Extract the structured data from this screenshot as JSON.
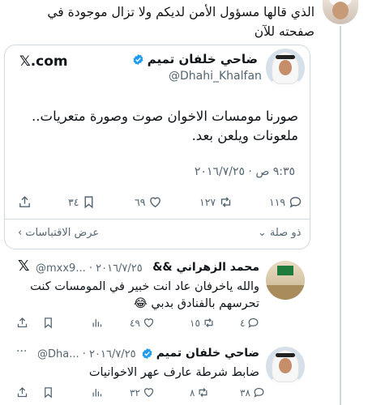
{
  "top_comment": {
    "text": "الذي قالها مسؤول الأمن لديكم ولا تزال موجودة في صفحته للآن"
  },
  "card": {
    "brand": "𝕏.com",
    "author_name": "ضاحي خلفان تميم",
    "author_handle": "@Dhahi_Khalfan",
    "tweet_text": "صورنا مومسات الاخوان صوت وصورة متعريات.. ملعونات ويلعن بعد.",
    "timestamp": "٩:٣٥ ص · ٢٠١٦/٧/٢٥",
    "counts": {
      "replies": "١١٩",
      "retweets": "١٢٧",
      "likes": "٦٩",
      "bookmarks": "٣٤"
    },
    "thread_label": "ذو صلة",
    "quotes_label": "عرض الاقتباسات"
  },
  "reply1": {
    "author_name": "محمد الزهراني &&",
    "handle_date": "@mxx9... · ٢٠١٦/٧/٢٥",
    "text_line1": "والله ياخرفان عاد انت خبير في المومسات كنت",
    "text_line2": "تحرسهم بالفنادق بدبي 😂",
    "counts": {
      "replies": "٤",
      "retweets": "١٥",
      "likes": "٤٩"
    }
  },
  "reply2": {
    "author_name": "ضاحي خلفان تميم",
    "handle_date": "@Dha... · ٢٠١٦/٧/٢٥",
    "more": "···",
    "text": "ضابط شرطة عارف عهر الاخوانيات",
    "counts": {
      "replies": "٣٨",
      "retweets": "٨",
      "likes": "٣٢"
    }
  }
}
